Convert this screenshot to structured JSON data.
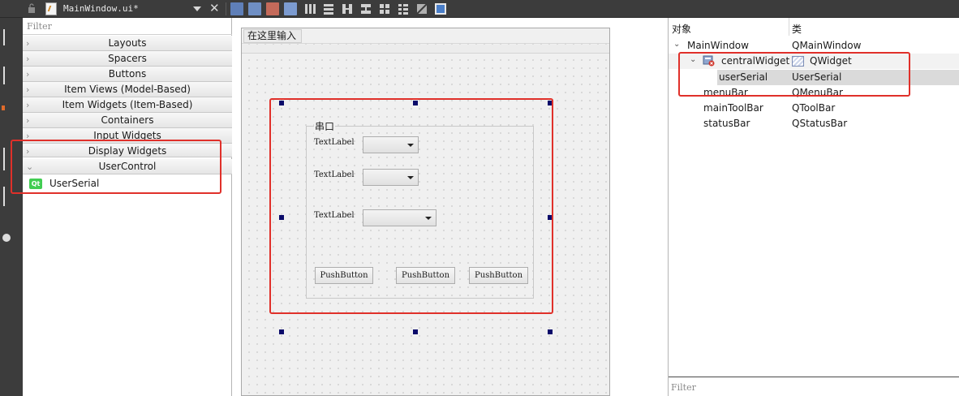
{
  "toolbar": {
    "file_title": "MainWindow.ui*"
  },
  "widget_box": {
    "filter_placeholder": "Filter",
    "categories": [
      {
        "label": "Layouts",
        "expanded": false
      },
      {
        "label": "Spacers",
        "expanded": false
      },
      {
        "label": "Buttons",
        "expanded": false
      },
      {
        "label": "Item Views (Model-Based)",
        "expanded": false
      },
      {
        "label": "Item Widgets (Item-Based)",
        "expanded": false
      },
      {
        "label": "Containers",
        "expanded": false
      },
      {
        "label": "Input Widgets",
        "expanded": false
      },
      {
        "label": "Display Widgets",
        "expanded": false
      },
      {
        "label": "UserControl",
        "expanded": true
      }
    ],
    "user_item": {
      "icon_text": "Qt",
      "label": "UserSerial"
    }
  },
  "form": {
    "menu_placeholder": "在这里输入",
    "groupbox_title": "串口",
    "labels": [
      "TextLabel",
      "TextLabel",
      "TextLabel"
    ],
    "buttons": [
      "PushButton",
      "PushButton",
      "PushButton"
    ]
  },
  "inspector": {
    "col_object": "对象",
    "col_class": "类",
    "rows": [
      {
        "name": "MainWindow",
        "cls": "QMainWindow"
      },
      {
        "name": "centralWidget",
        "cls": "QWidget"
      },
      {
        "name": "userSerial",
        "cls": "UserSerial"
      },
      {
        "name": "menuBar",
        "cls": "QMenuBar"
      },
      {
        "name": "mainToolBar",
        "cls": "QToolBar"
      },
      {
        "name": "statusBar",
        "cls": "QStatusBar"
      }
    ],
    "filter_placeholder": "Filter"
  },
  "colors": {
    "highlight": "#e0302a",
    "selection_handle": "#0a0a6a",
    "qt_green": "#41cd52",
    "dark_chrome": "#3c3c3c"
  }
}
